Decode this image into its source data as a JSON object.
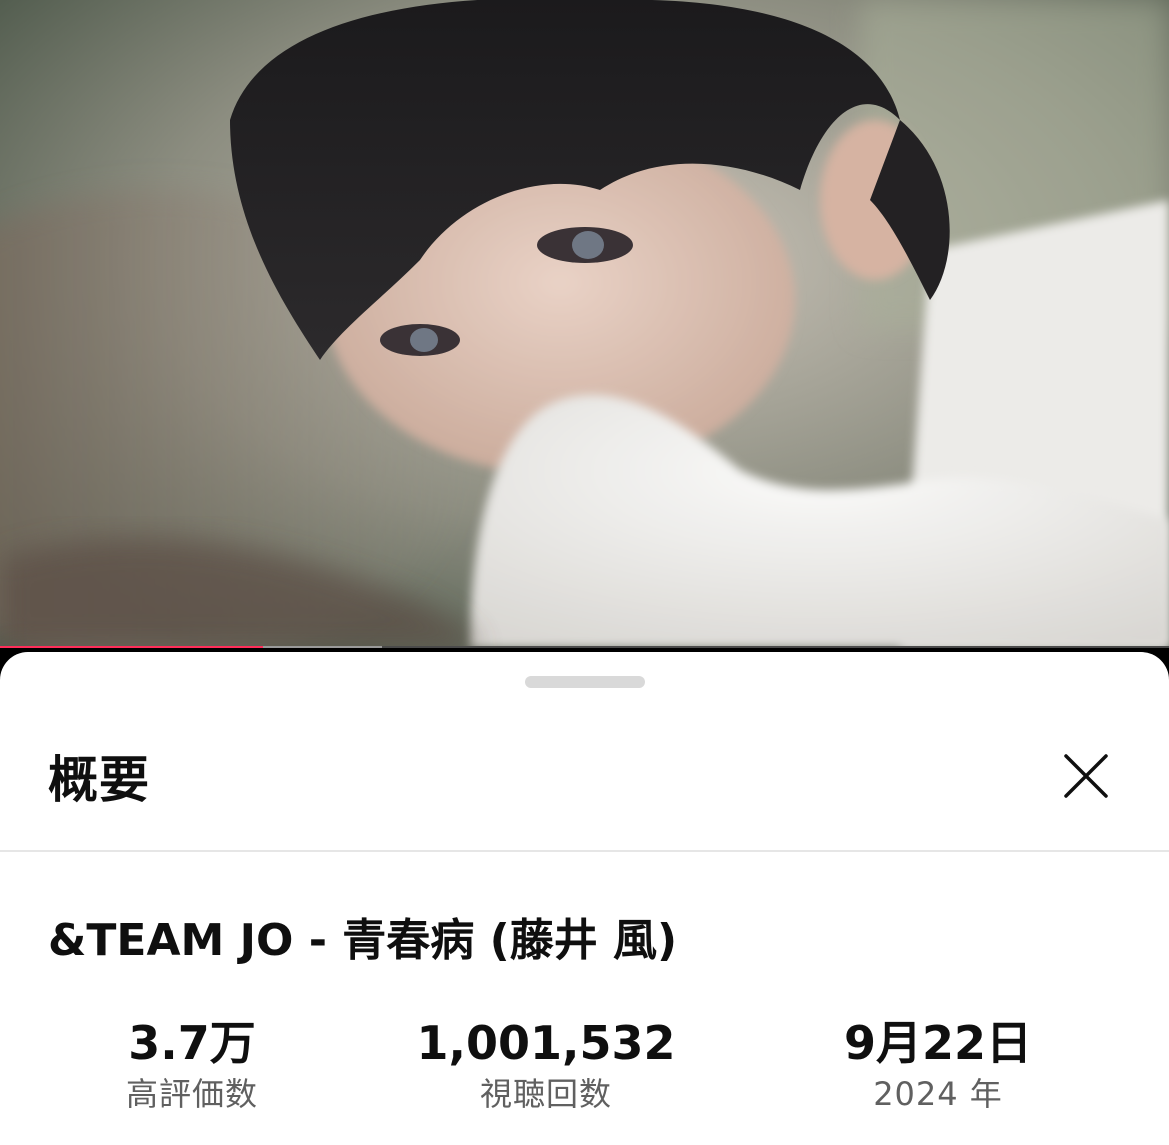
{
  "video": {
    "thumbnail_alt": "",
    "progress_fraction": 0.225,
    "buffered_fraction": 0.327,
    "colors": {
      "played": "#ff2e5a",
      "buffered": "#9a9a9a",
      "track": "#4a4a4a"
    }
  },
  "sheet": {
    "title": "概要",
    "close_icon": "close-icon",
    "video_title": "&TEAM JO - 青春病 (藤井 風)",
    "stats": [
      {
        "value": "3.7万",
        "label": "高評価数"
      },
      {
        "value": "1,001,532",
        "label": "視聴回数"
      },
      {
        "value": "9月22日",
        "label": "2024 年"
      }
    ]
  }
}
